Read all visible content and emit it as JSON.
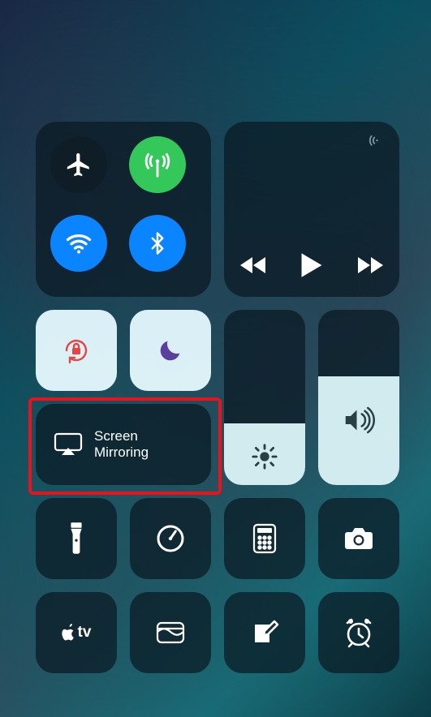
{
  "connectivity": {
    "airplane": {
      "name": "airplane-mode",
      "on": false
    },
    "cellular": {
      "name": "cellular-data",
      "on": true
    },
    "wifi": {
      "name": "wifi",
      "on": true
    },
    "bluetooth": {
      "name": "bluetooth",
      "on": true
    }
  },
  "media": {
    "rewind": "previous-track",
    "play": "play-pause",
    "forward": "next-track"
  },
  "toggles": {
    "orientation_lock": {
      "name": "rotation-lock",
      "on": true
    },
    "dnd": {
      "name": "do-not-disturb",
      "on": true
    }
  },
  "screen_mirroring": {
    "label_line1": "Screen",
    "label_line2": "Mirroring"
  },
  "sliders": {
    "brightness": {
      "name": "brightness",
      "level_pct": 35
    },
    "volume": {
      "name": "volume",
      "level_pct": 62
    }
  },
  "shortcuts_row1": [
    {
      "name": "flashlight"
    },
    {
      "name": "timer"
    },
    {
      "name": "calculator"
    },
    {
      "name": "camera"
    }
  ],
  "shortcuts_row2": [
    {
      "name": "apple-tv-remote",
      "label": "tv"
    },
    {
      "name": "wallet"
    },
    {
      "name": "notes-quick"
    },
    {
      "name": "alarm"
    }
  ],
  "colors": {
    "tile_dark": "rgba(10,25,35,0.72)",
    "tile_light": "rgba(230,250,255,0.95)",
    "green": "#34c759",
    "blue": "#0b84ff",
    "highlight": "#e8131d",
    "dnd_purple": "#5b3f9e",
    "lock_red": "#e54545"
  },
  "highlight_target": "screen-mirroring-button"
}
